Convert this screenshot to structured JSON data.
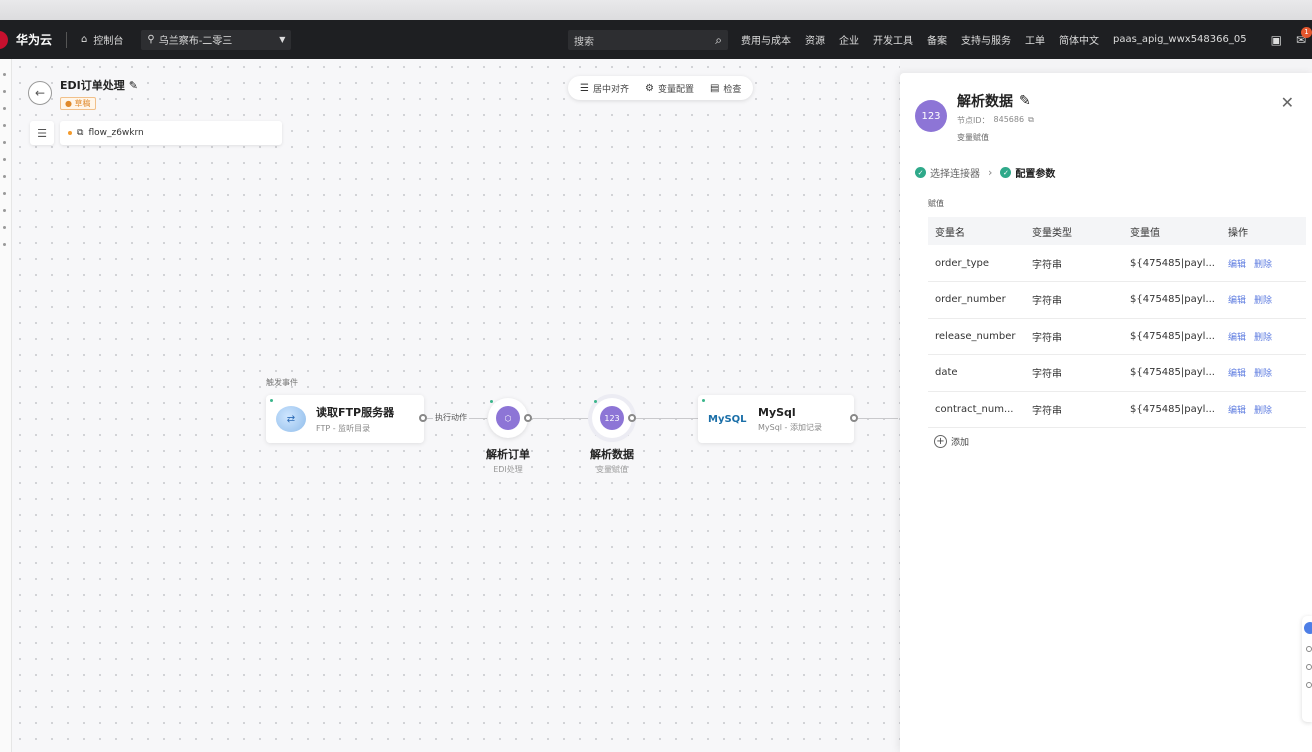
{
  "topbar": {
    "brand": "华为云",
    "console": "控制台",
    "region": "乌兰察布-二零三",
    "search_placeholder": "搜索",
    "nav": [
      "费用与成本",
      "资源",
      "企业",
      "开发工具",
      "备案",
      "支持与服务",
      "工单",
      "简体中文",
      "paas_apig_wwx548366_05"
    ],
    "notification_count": "1"
  },
  "flow": {
    "title": "EDI订单处理",
    "status": "草稿",
    "name": "flow_z6wkrn"
  },
  "toolbar": {
    "center_align": "居中对齐",
    "var_config": "变量配置",
    "check": "检查"
  },
  "canvas": {
    "trigger_label": "触发事件",
    "edge_label": "执行动作",
    "nodes": {
      "ftp": {
        "title": "读取FTP服务器",
        "sub": "FTP - 监听目录"
      },
      "parse_order": {
        "title": "解析订单",
        "sub": "EDI处理"
      },
      "parse_data": {
        "title": "解析数据",
        "sub": "变量赋值",
        "icon_text": "123"
      },
      "mysql": {
        "title": "MySql",
        "sub": "MySql - 添加记录",
        "logo": "MySQL"
      }
    }
  },
  "panel": {
    "title": "解析数据",
    "node_id_label": "节点ID：",
    "node_id": "845686",
    "subtitle": "变量赋值",
    "icon_text": "123",
    "steps": [
      "选择连接器",
      "配置参数"
    ],
    "section": "赋值",
    "columns": [
      "变量名",
      "变量类型",
      "变量值",
      "操作"
    ],
    "rows": [
      {
        "name": "order_type",
        "type": "字符串",
        "value": "${475485|payl...",
        "edit": "编辑",
        "delete": "删除"
      },
      {
        "name": "order_number",
        "type": "字符串",
        "value": "${475485|payl...",
        "edit": "编辑",
        "delete": "删除"
      },
      {
        "name": "release_number",
        "type": "字符串",
        "value": "${475485|payl...",
        "edit": "编辑",
        "delete": "删除"
      },
      {
        "name": "date",
        "type": "字符串",
        "value": "${475485|payl...",
        "edit": "编辑",
        "delete": "删除"
      },
      {
        "name": "contract_num...",
        "type": "字符串",
        "value": "${475485|payl...",
        "edit": "编辑",
        "delete": "删除"
      }
    ],
    "add_label": "添加"
  },
  "colors": {
    "accent_purple": "#8d75d6",
    "link_blue": "#5e7ce0",
    "success_green": "#2fa98a",
    "topbar_bg": "#1e1f22"
  }
}
